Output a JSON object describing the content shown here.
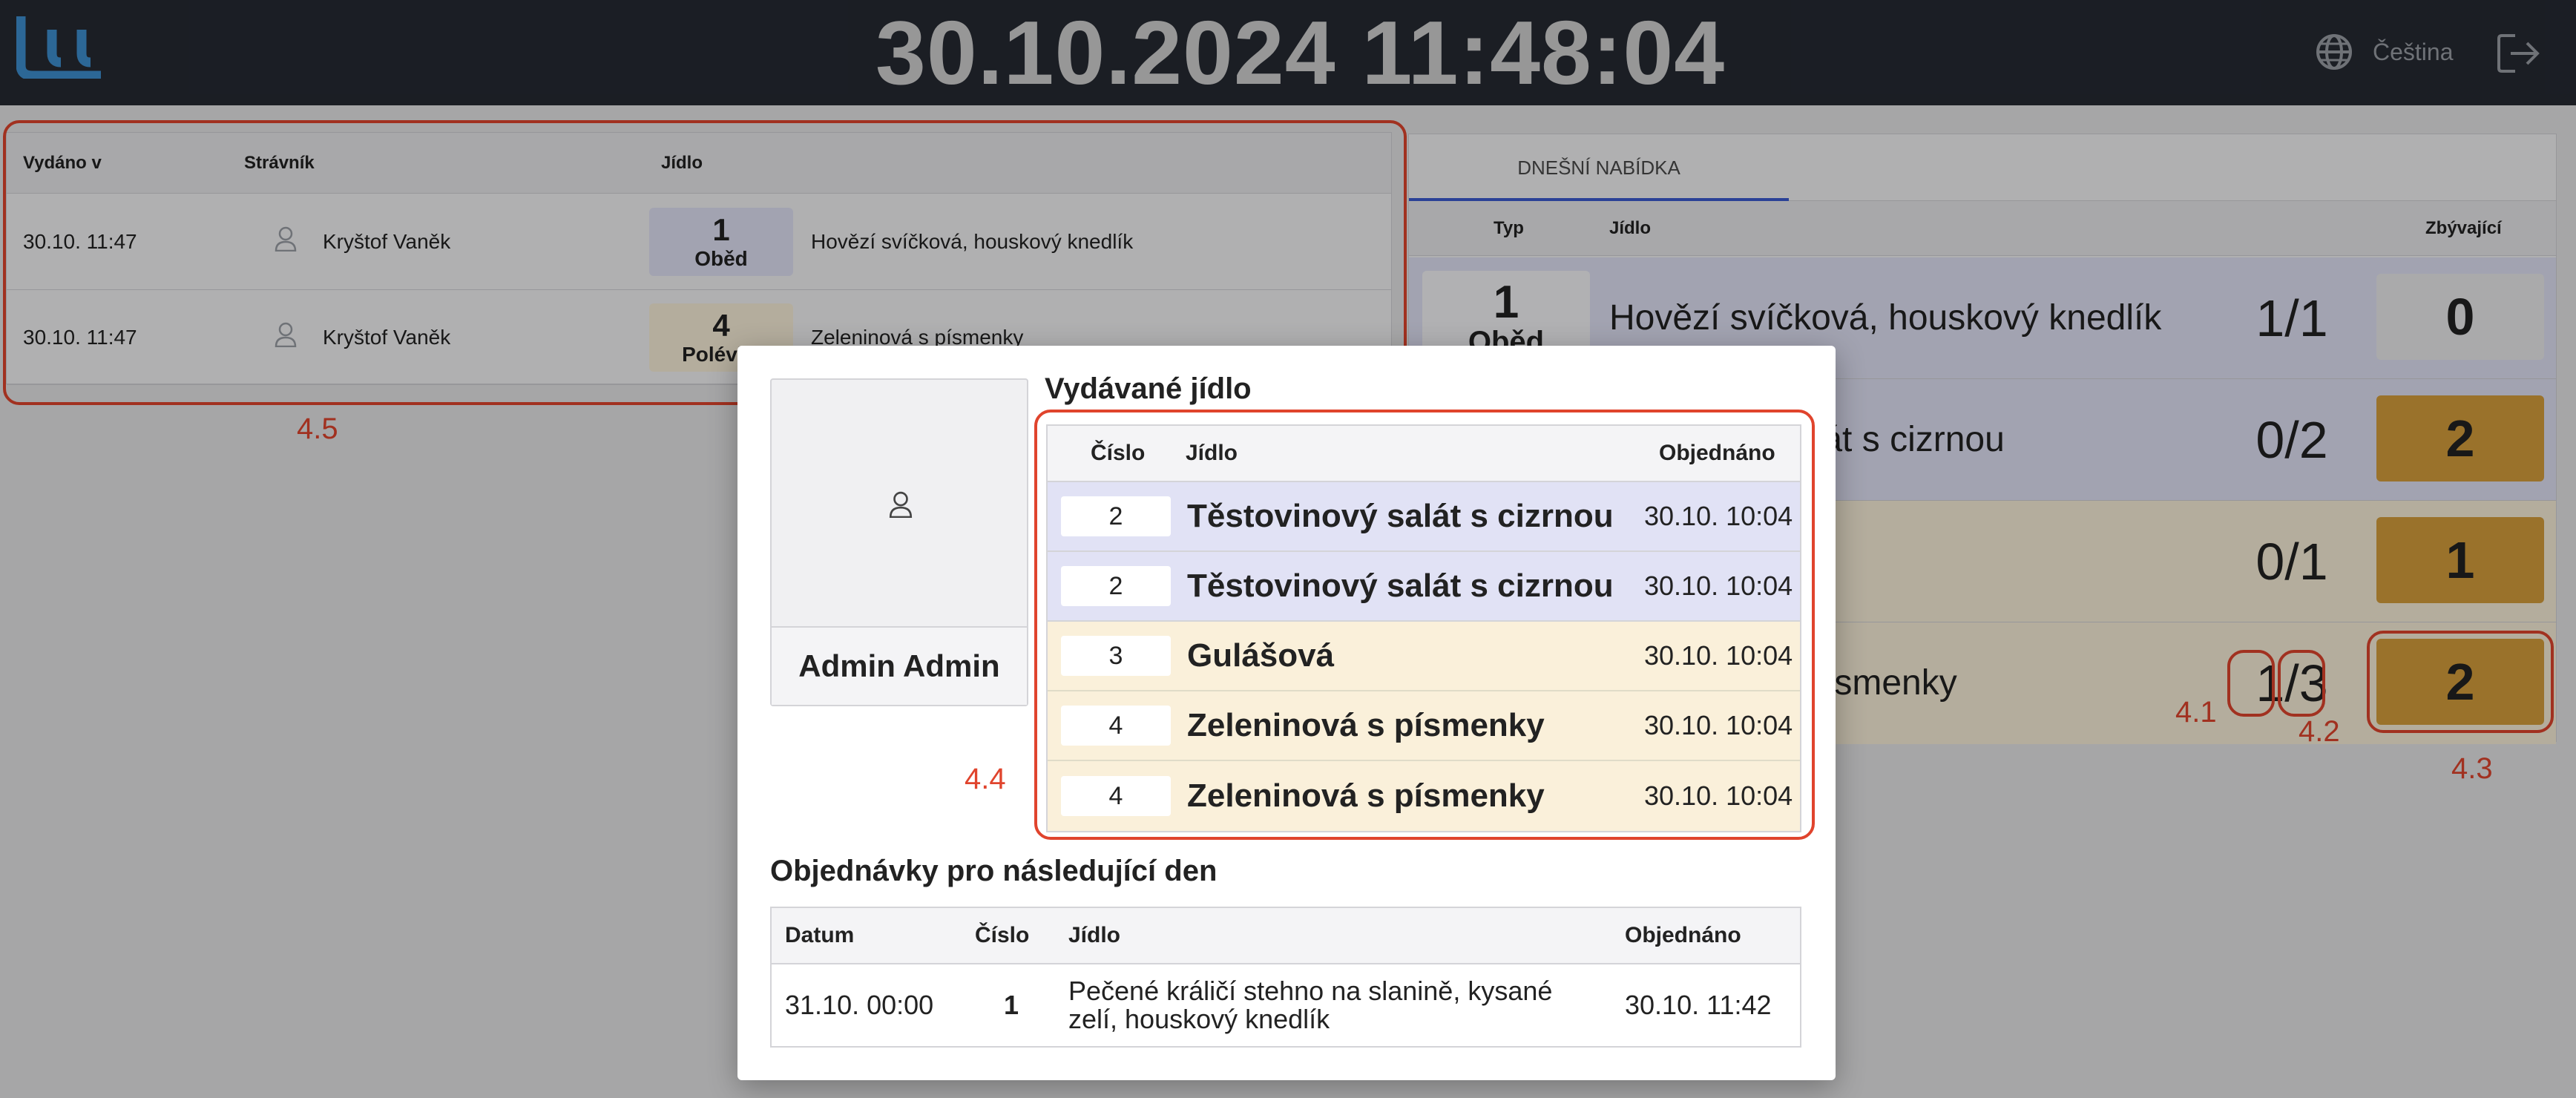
{
  "header": {
    "clock": "30.10.2024 11:48:04",
    "language": "Čeština"
  },
  "colors": {
    "header_bg": "#262a33",
    "logo": "#3e8fd0",
    "lunch_bg": "#e1e2f5",
    "soup_bg": "#faf0da",
    "remaining_orange": "#d69f3c",
    "annotation_red": "#e0442d",
    "tab_underline": "#3b5bd0"
  },
  "issued": {
    "columns": [
      "Vydáno v",
      "Strávník",
      "Jídlo"
    ],
    "rows": [
      {
        "time": "30.10. 11:47",
        "diner": "Kryštof Vaněk",
        "number": "1",
        "type": "Oběd",
        "meal": "Hovězí svíčková, houskový knedlík"
      },
      {
        "time": "30.10. 11:47",
        "diner": "Kryštof Vaněk",
        "number": "4",
        "type": "Polévka",
        "meal": "Zeleninová s písmenky"
      }
    ]
  },
  "menu": {
    "tab": "DNEŠNÍ NABÍDKA",
    "columns": [
      "Typ",
      "Jídlo",
      "Zbývající"
    ],
    "rows": [
      {
        "number": "1",
        "type": "Oběd",
        "meal": "Hovězí svíčková, houskový knedlík",
        "fraction": "1/1",
        "remaining": "0"
      },
      {
        "meal": "alát s cizrnou",
        "fraction": "0/2",
        "remaining": "2"
      },
      {
        "fraction": "0/1",
        "remaining": "1"
      },
      {
        "meal": "ísmenky",
        "fraction_a": "1",
        "fraction_sep": "/",
        "fraction_b": "3",
        "remaining": "2"
      }
    ]
  },
  "modal": {
    "avatar_name": "Admin Admin",
    "issued_title": "Vydávané jídlo",
    "issued_columns": [
      "Číslo",
      "Jídlo",
      "Objednáno"
    ],
    "issued_rows": [
      {
        "number": "2",
        "meal": "Těstovinový salát s cizrnou",
        "ordered": "30.10. 10:04"
      },
      {
        "number": "2",
        "meal": "Těstovinový salát s cizrnou",
        "ordered": "30.10. 10:04"
      },
      {
        "number": "3",
        "meal": "Gulášová",
        "ordered": "30.10. 10:04"
      },
      {
        "number": "4",
        "meal": "Zeleninová s písmenky",
        "ordered": "30.10. 10:04"
      },
      {
        "number": "4",
        "meal": "Zeleninová s písmenky",
        "ordered": "30.10. 10:04"
      }
    ],
    "next_title": "Objednávky pro následující den",
    "next_columns": [
      "Datum",
      "Číslo",
      "Jídlo",
      "Objednáno"
    ],
    "next_rows": [
      {
        "date": "31.10. 00:00",
        "number": "1",
        "meal": "Pečené králičí stehno na slanině, kysané zelí, houskový knedlík",
        "ordered": "30.10. 11:42"
      }
    ]
  },
  "annotations": {
    "a41": "4.1",
    "a42": "4.2",
    "a43": "4.3",
    "a44": "4.4",
    "a45": "4.5"
  }
}
